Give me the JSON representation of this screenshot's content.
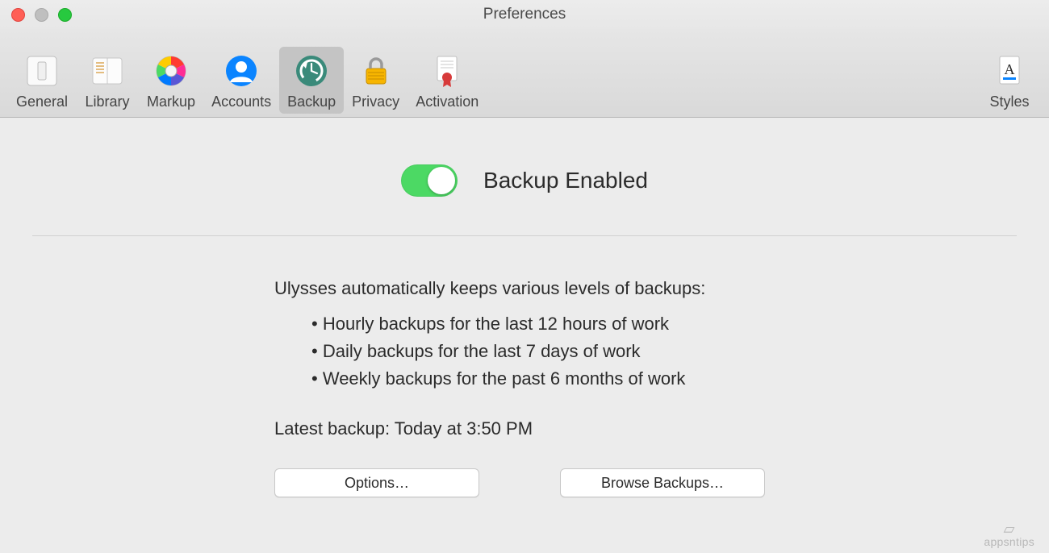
{
  "window": {
    "title": "Preferences"
  },
  "toolbar": {
    "items": [
      {
        "label": "General"
      },
      {
        "label": "Library"
      },
      {
        "label": "Markup"
      },
      {
        "label": "Accounts"
      },
      {
        "label": "Backup"
      },
      {
        "label": "Privacy"
      },
      {
        "label": "Activation"
      }
    ],
    "right_item": {
      "label": "Styles"
    },
    "selected_index": 4
  },
  "main": {
    "toggle_label": "Backup Enabled",
    "toggle_on": true,
    "intro": "Ulysses automatically keeps various levels of backups:",
    "bullets": [
      "Hourly backups for the last 12 hours of work",
      "Daily backups for the last 7 days of work",
      "Weekly backups for the past 6 months of work"
    ],
    "latest_label": "Latest backup: Today at 3:50 PM",
    "options_button": "Options…",
    "browse_button": "Browse Backups…"
  },
  "watermark": "appsntips"
}
